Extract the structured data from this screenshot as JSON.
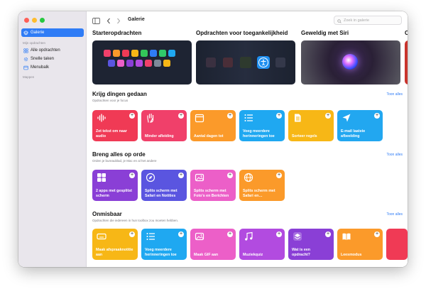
{
  "sidebar": {
    "active_item": "Galerie",
    "section_my": "Mijn opdrachten",
    "items": [
      "Alle opdrachten",
      "Snelle taken",
      "Menubalk"
    ],
    "section_folders": "Mappen"
  },
  "toolbar": {
    "title": "Galerie",
    "search_placeholder": "Zoek in galerie"
  },
  "featured": [
    {
      "title": "Starteropdrachten"
    },
    {
      "title": "Opdrachten voor toegankelijkheid"
    },
    {
      "title": "Geweldig met Siri"
    },
    {
      "title": "C"
    }
  ],
  "sections": [
    {
      "title": "Krijg dingen gedaan",
      "subtitle": "Opdrachten voor je focus",
      "show_all": "Toon alles",
      "cards": [
        {
          "label": "Zet tekst om naar audio",
          "color": "#f03a55",
          "icon": "waveform-icon"
        },
        {
          "label": "Minder afleiding",
          "color": "#f0406a",
          "icon": "hand-icon"
        },
        {
          "label": "Aantal dagen tot",
          "color": "#fb9a2a",
          "icon": "calendar-icon"
        },
        {
          "label": "Voeg meerdere herinneringen toe",
          "color": "#1fa8f1",
          "icon": "list-icon"
        },
        {
          "label": "Sorteer regels",
          "color": "#f7b716",
          "icon": "document-icon"
        },
        {
          "label": "E-mail laatste afbeelding",
          "color": "#22a7f0",
          "icon": "paperplane-icon"
        }
      ]
    },
    {
      "title": "Breng alles op orde",
      "subtitle": "Orden je bureaublad, je Mac en al het andere",
      "show_all": "Toon alles",
      "cards": [
        {
          "label": "2 apps met gesplitst scherm",
          "color": "#8a3fd6",
          "icon": "grid-icon"
        },
        {
          "label": "Splits scherm met Safari en Notities",
          "color": "#5a55e0",
          "icon": "compass-icon"
        },
        {
          "label": "Splits scherm met Foto's en Berichten",
          "color": "#ec5fc8",
          "icon": "photo-icon"
        },
        {
          "label": "Splits scherm met Safari en…",
          "color": "#fb9a2a",
          "icon": "globe-icon"
        }
      ]
    },
    {
      "title": "Onmisbaar",
      "subtitle": "Opdrachten die iedereen in hun toolbox zou moeten hebben.",
      "show_all": "Toon alles",
      "cards": [
        {
          "label": "Maak afspraaknotitie aan",
          "color": "#f7b716",
          "icon": "keyboard-icon"
        },
        {
          "label": "Voeg meerdere herinneringen toe",
          "color": "#1fa8f1",
          "icon": "list-icon"
        },
        {
          "label": "Maak GIF aan",
          "color": "#ec5fc8",
          "icon": "photo-icon"
        },
        {
          "label": "Muziekquiz",
          "color": "#b24be0",
          "icon": "music-icon"
        },
        {
          "label": "Wat is een opdracht?",
          "color": "#8a3fd6",
          "icon": "layers-icon"
        },
        {
          "label": "Leesmodus",
          "color": "#fb9a2a",
          "icon": "book-icon"
        }
      ]
    }
  ],
  "colors": {
    "accent": "#2f7cf6",
    "sidebar_bg": "#e9e6ec"
  }
}
